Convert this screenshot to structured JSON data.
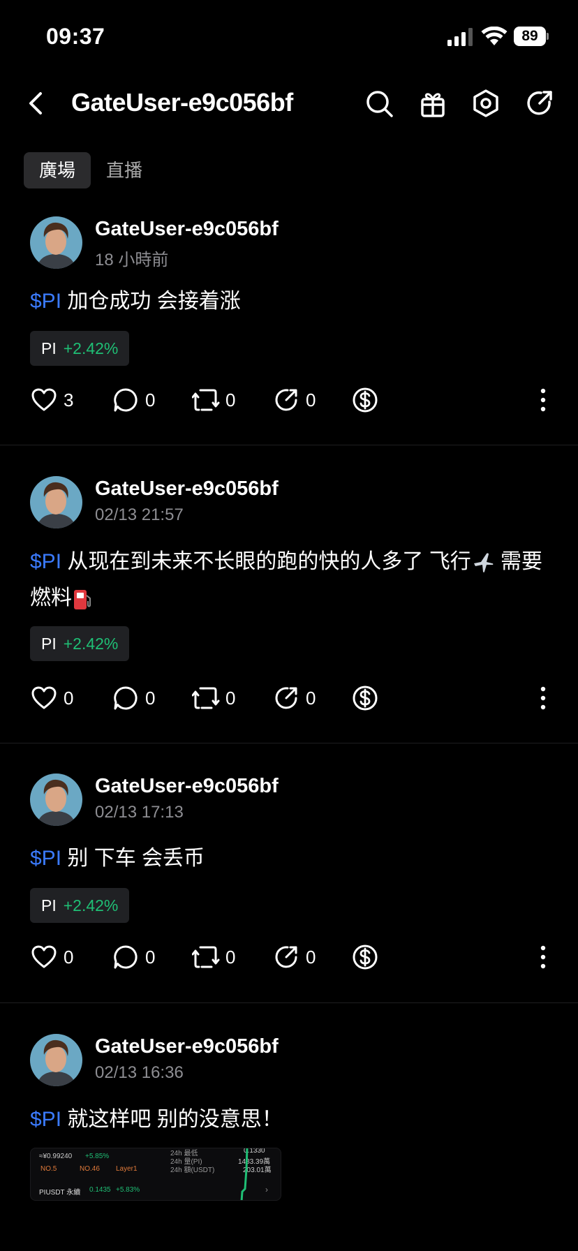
{
  "status": {
    "time": "09:37",
    "battery": "89"
  },
  "header": {
    "title": "GateUser-e9c056bf"
  },
  "tabs": [
    {
      "label": "廣場",
      "active": true
    },
    {
      "label": "直播",
      "active": false
    }
  ],
  "posts": [
    {
      "author": "GateUser-e9c056bf",
      "time": "18 小時前",
      "ticker": "$PI",
      "text": " 加仓成功 会接着涨",
      "chip": {
        "symbol": "PI",
        "change": "+2.42%"
      },
      "likes": "3",
      "comments": "0",
      "reposts": "0",
      "shares": "0"
    },
    {
      "author": "GateUser-e9c056bf",
      "time": "02/13 21:57",
      "ticker": "$PI",
      "text": " 从现在到未来不长眼的跑的快的人多了 飞行",
      "text2": " 需要燃料",
      "chip": {
        "symbol": "PI",
        "change": "+2.42%"
      },
      "likes": "0",
      "comments": "0",
      "reposts": "0",
      "shares": "0"
    },
    {
      "author": "GateUser-e9c056bf",
      "time": "02/13 17:13",
      "ticker": "$PI",
      "text": " 别 下车 会丢币",
      "chip": {
        "symbol": "PI",
        "change": "+2.42%"
      },
      "likes": "0",
      "comments": "0",
      "reposts": "0",
      "shares": "0"
    },
    {
      "author": "GateUser-e9c056bf",
      "time": "02/13 16:36",
      "ticker": "$PI",
      "text": " 就这样吧 别的没意思！",
      "preview": {
        "price": "≈¥0.99240",
        "price_change": "+5.85%",
        "rank1": "NO.5",
        "rank2": "NO.46",
        "tag": "Layer1",
        "r1_label": "24h 最低",
        "r1_value": "0.1330",
        "r2_label": "24h 量(PI)",
        "r2_value": "1483.39萬",
        "r3_label": "24h 額(USDT)",
        "r3_value": "203.01萬",
        "pair": "PIUSDT 永續",
        "pair_price": "0.1435",
        "pair_change": "+5.83%"
      }
    }
  ],
  "colors": {
    "link": "#3b7bff",
    "up": "#1fbf75",
    "muted": "#8e8e93"
  }
}
